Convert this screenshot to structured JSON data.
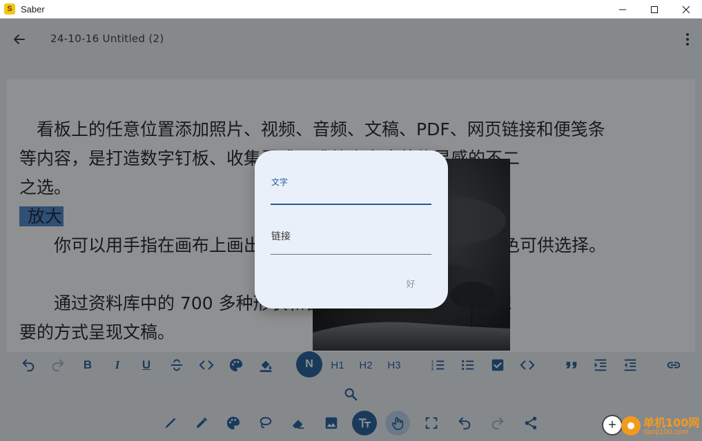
{
  "window": {
    "app_icon_letter": "S",
    "title": "Saber",
    "controls": [
      "minimize",
      "maximize",
      "close"
    ]
  },
  "appbar": {
    "document_title": "24-10-16 Untitled (2)",
    "back_icon": "arrow-left-icon",
    "more_icon": "more-vertical-icon"
  },
  "canvas": {
    "lines": [
      "　看板上的任意位置添加照片、视频、音频、文稿、PDF、网页链接和便笺条",
      "等内容，是打造数字钉板、收集灵感、或整合家庭装修灵感的不二",
      "之选。",
      "放大",
      "　　你可以用手指在画布上画出各种笔画，有多种笔刷样式和颜色可供选择。",
      "",
      "　　通过资料库中的 700 多种形状和智能辅助对齐参考线以你想",
      "要的方式呈现文稿。"
    ],
    "highlighted_text": "放大"
  },
  "format_toolbar": {
    "normal_label": "N",
    "h1": "H1",
    "h2": "H2",
    "h3": "H3",
    "bold": "B",
    "italic": "I",
    "underline": "U"
  },
  "dialog": {
    "text_label": "文字",
    "text_value": "",
    "link_label": "链接",
    "ok_label": "好"
  },
  "watermark": {
    "plus": "+",
    "site_name": "单机100网",
    "site_url": "danji100.com"
  },
  "colors": {
    "accent": "#1f5b99",
    "dialog_bg": "#eaf0fa",
    "highlight": "#4a83c8",
    "watermark": "#f39a1e"
  }
}
